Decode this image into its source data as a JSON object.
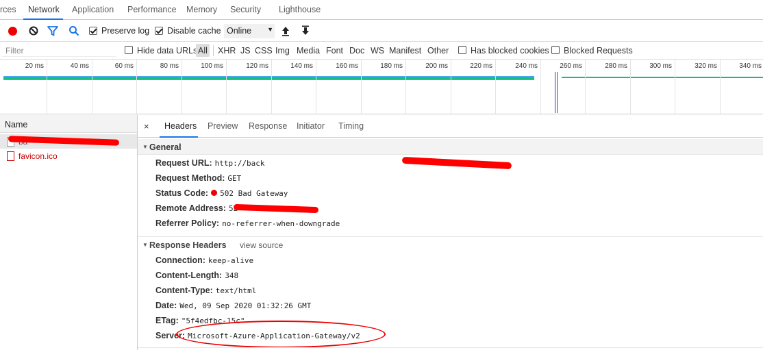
{
  "tabs": [
    {
      "label": "rces"
    },
    {
      "label": "Network"
    },
    {
      "label": "Application"
    },
    {
      "label": "Performance"
    },
    {
      "label": "Memory"
    },
    {
      "label": "Security"
    },
    {
      "label": "Lighthouse"
    }
  ],
  "toolbar": {
    "preserve_log": "Preserve log",
    "disable_cache": "Disable cache",
    "throttling": "Online",
    "caret": "▼"
  },
  "filterbar": {
    "placeholder": "Filter",
    "hide_data_urls": "Hide data URLs",
    "types": [
      "All",
      "XHR",
      "JS",
      "CSS",
      "Img",
      "Media",
      "Font",
      "Doc",
      "WS",
      "Manifest",
      "Other"
    ],
    "has_blocked_cookies": "Has blocked cookies",
    "blocked_requests": "Blocked Requests"
  },
  "overview": {
    "ticks": [
      "20 ms",
      "40 ms",
      "60 ms",
      "80 ms",
      "100 ms",
      "120 ms",
      "140 ms",
      "160 ms",
      "180 ms",
      "200 ms",
      "220 ms",
      "240 ms",
      "260 ms",
      "280 ms",
      "300 ms",
      "320 ms",
      "340 ms"
    ]
  },
  "requests": {
    "header": "Name",
    "items": [
      {
        "name": "ba"
      },
      {
        "name": "favicon.ico"
      }
    ]
  },
  "details": {
    "close": "×",
    "tabs": [
      "Headers",
      "Preview",
      "Response",
      "Initiator",
      "Timing"
    ],
    "general": {
      "title": "General",
      "rows": [
        {
          "key": "Request URL:",
          "value": "http://back"
        },
        {
          "key": "Request Method:",
          "value": "GET"
        },
        {
          "key": "Status Code:",
          "value": "502 Bad Gateway"
        },
        {
          "key": "Remote Address:",
          "value": "52"
        },
        {
          "key": "Referrer Policy:",
          "value": "no-referrer-when-downgrade"
        }
      ]
    },
    "response_headers": {
      "title": "Response Headers",
      "view_source": "view source",
      "rows": [
        {
          "key": "Connection:",
          "value": "keep-alive"
        },
        {
          "key": "Content-Length:",
          "value": "348"
        },
        {
          "key": "Content-Type:",
          "value": "text/html"
        },
        {
          "key": "Date:",
          "value": "Wed, 09 Sep 2020 01:32:26 GMT"
        },
        {
          "key": "ETag:",
          "value": "\"5f4edfbc-15c\""
        },
        {
          "key": "Server:",
          "value": "Microsoft-Azure-Application-Gateway/v2"
        }
      ]
    }
  },
  "colors": {
    "accent": "#1a73e8",
    "record": "#ee0000",
    "waterfall": "#13c27a",
    "annotation": "#ee0000"
  }
}
